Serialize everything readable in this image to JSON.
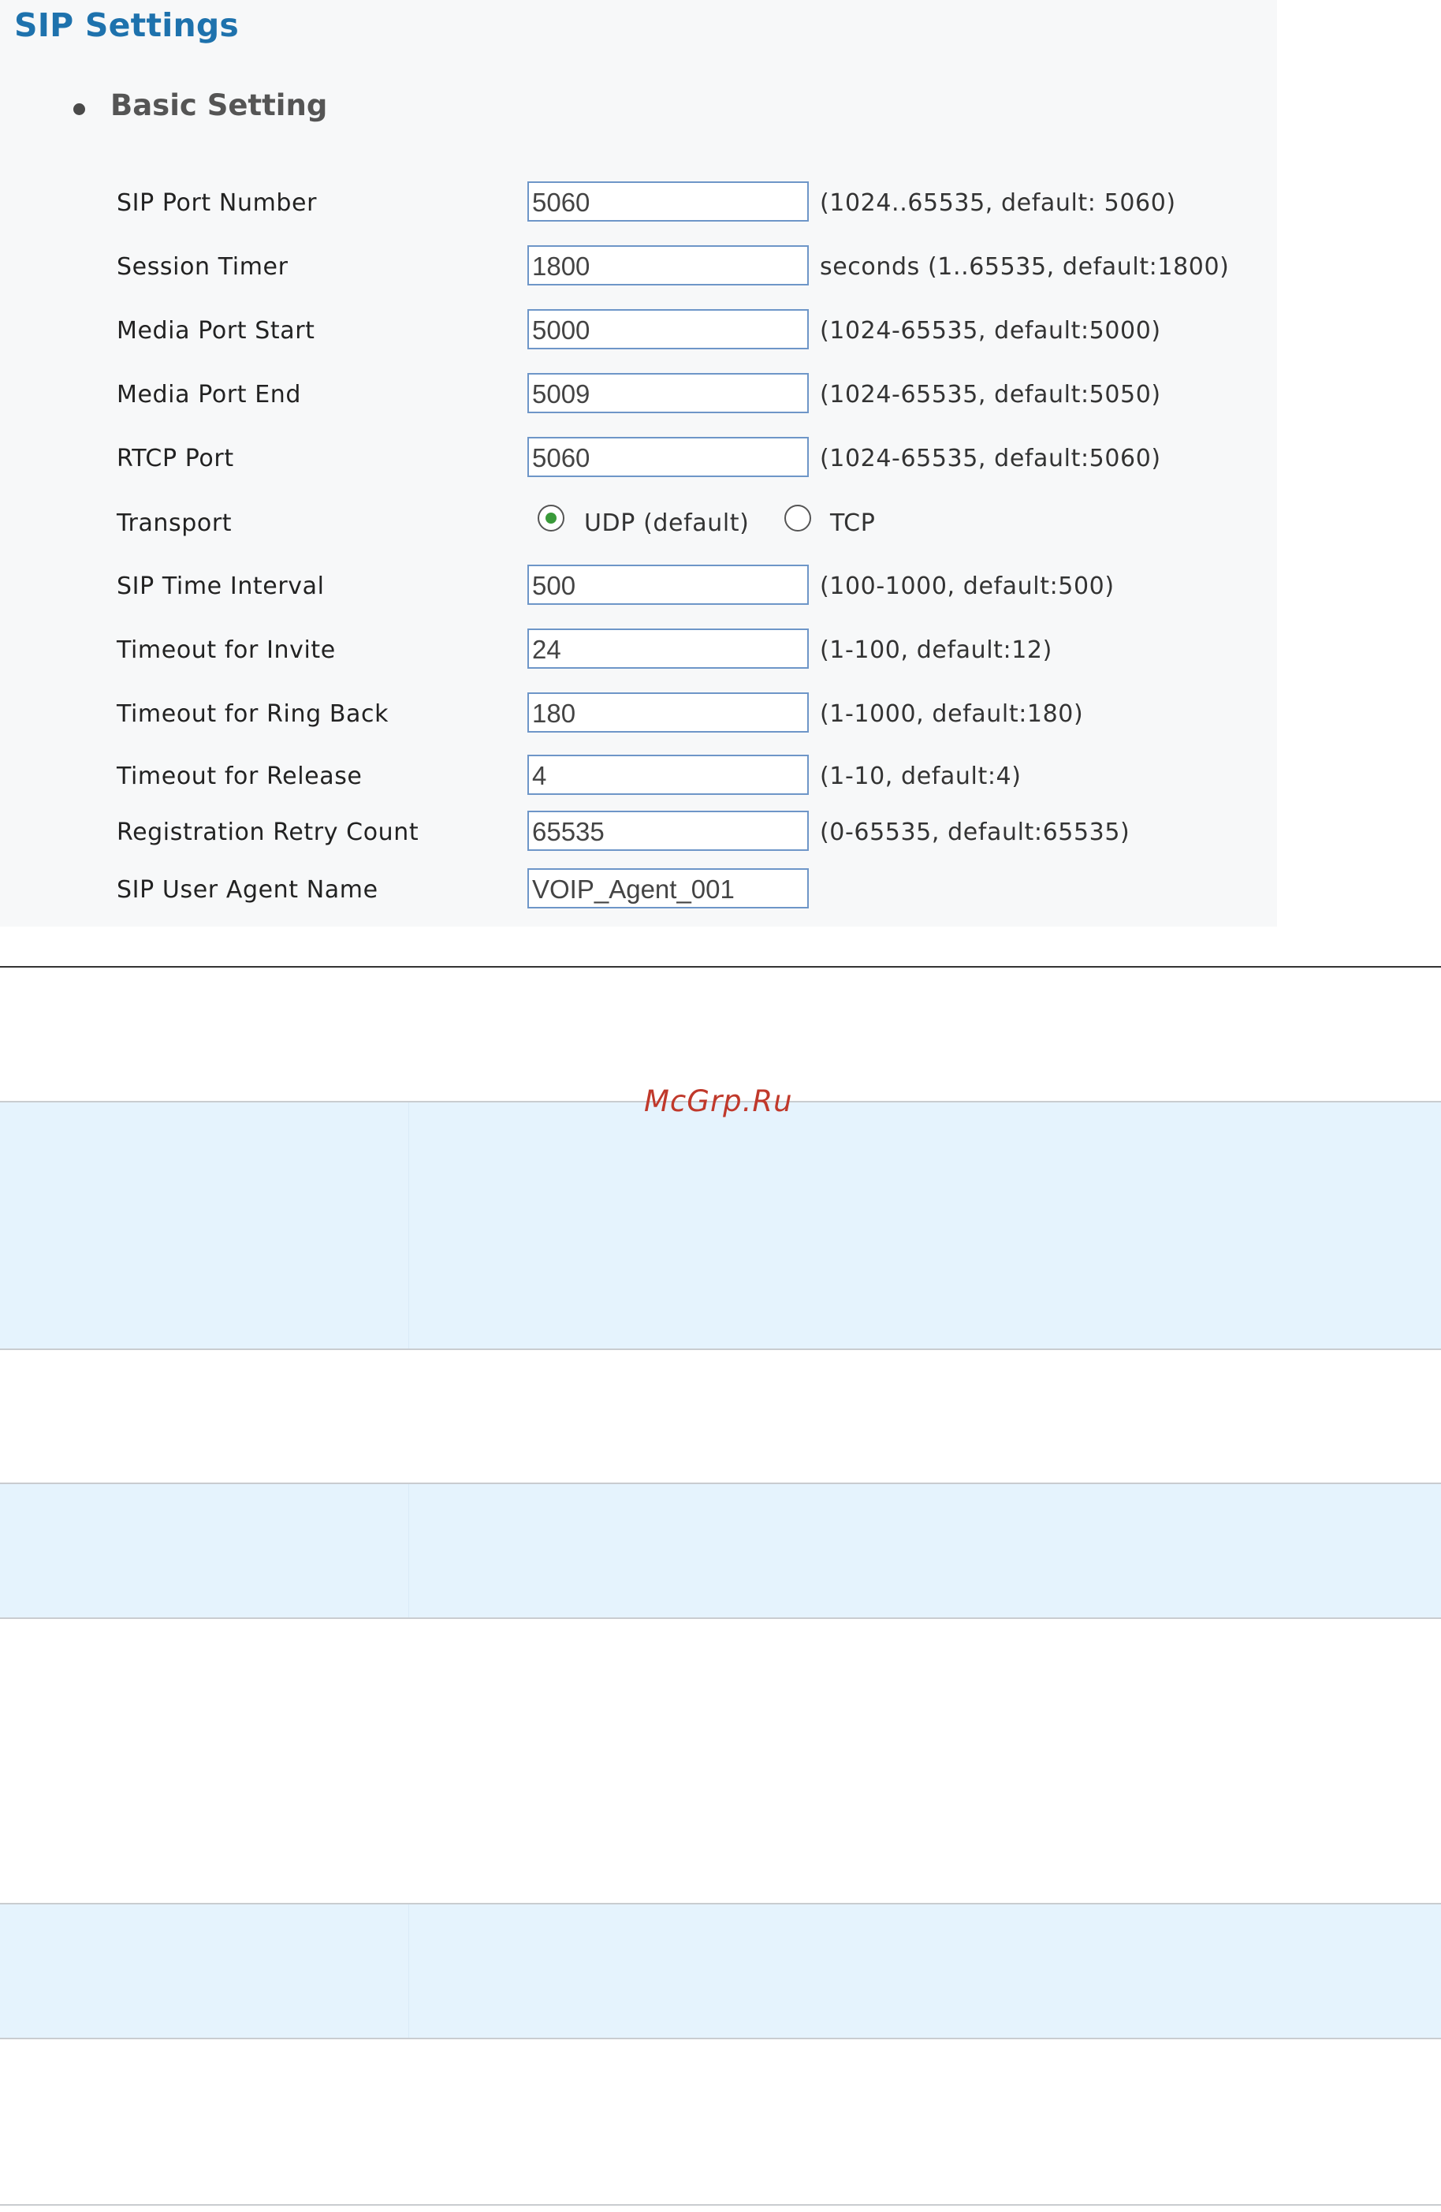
{
  "page": {
    "title": "SIP Settings",
    "section_title": "Basic Setting",
    "watermark": "McGrp.Ru"
  },
  "form": {
    "rows": [
      {
        "label": "SIP Port Number",
        "value": "5060",
        "hint": "(1024..65535, default: 5060)"
      },
      {
        "label": "Session Timer",
        "value": "1800",
        "hint": "seconds (1..65535, default:1800)"
      },
      {
        "label": "Media Port Start",
        "value": "5000",
        "hint": "(1024-65535, default:5000)"
      },
      {
        "label": "Media Port End",
        "value": "5009",
        "hint": "(1024-65535, default:5050)"
      },
      {
        "label": "RTCP Port",
        "value": "5060",
        "hint": "(1024-65535, default:5060)"
      },
      {
        "label": "SIP Time Interval",
        "value": "500",
        "hint": "(100-1000, default:500)"
      },
      {
        "label": "Timeout for Invite",
        "value": "24",
        "hint": "(1-100, default:12)"
      },
      {
        "label": "Timeout for Ring Back",
        "value": "180",
        "hint": "(1-1000, default:180)"
      },
      {
        "label": "Timeout for Release",
        "value": "4",
        "hint": "(1-10, default:4)"
      },
      {
        "label": "Registration Retry Count",
        "value": "65535",
        "hint": "(0-65535, default:65535)"
      },
      {
        "label": "SIP User Agent Name",
        "value": "VOIP_Agent_001",
        "hint": ""
      }
    ],
    "transport": {
      "label": "Transport",
      "options": [
        "UDP (default)",
        "TCP"
      ],
      "selected": "UDP (default)"
    }
  },
  "colors": {
    "title": "#1e72ad",
    "field_border": "#6e96c8",
    "band_fill": "#e5f3fd",
    "watermark": "#c0392b",
    "radio_selected": "#3a9a3a"
  }
}
